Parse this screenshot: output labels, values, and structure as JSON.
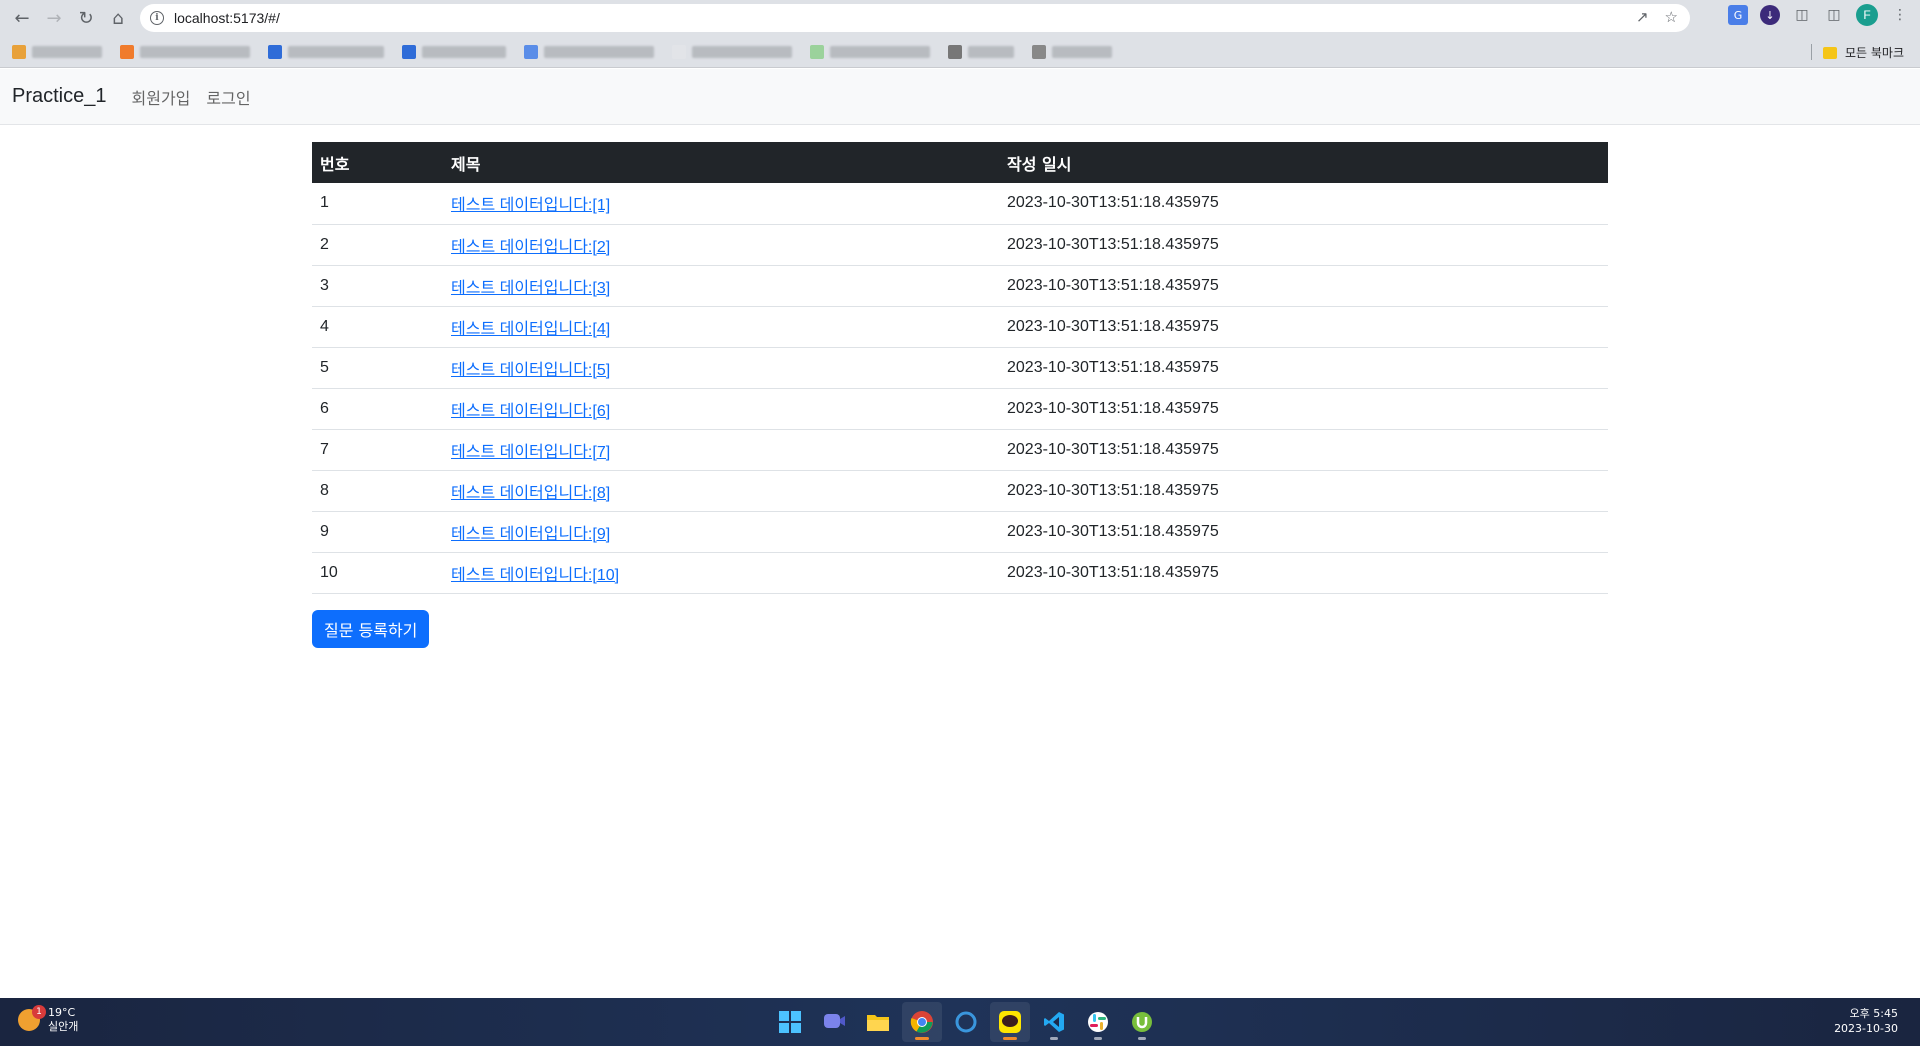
{
  "browser": {
    "url": "localhost:5173/#/",
    "all_bookmarks_label": "모든 북마크",
    "profile_initial": "F"
  },
  "app": {
    "brand": "Practice_1",
    "nav": {
      "signup": "회원가입",
      "login": "로그인"
    }
  },
  "table": {
    "headers": [
      "번호",
      "제목",
      "작성 일시"
    ],
    "rows": [
      {
        "num": "1",
        "title": "테스트 데이터입니다:[1]",
        "date": "2023-10-30T13:51:18.435975"
      },
      {
        "num": "2",
        "title": "테스트 데이터입니다:[2]",
        "date": "2023-10-30T13:51:18.435975"
      },
      {
        "num": "3",
        "title": "테스트 데이터입니다:[3]",
        "date": "2023-10-30T13:51:18.435975"
      },
      {
        "num": "4",
        "title": "테스트 데이터입니다:[4]",
        "date": "2023-10-30T13:51:18.435975"
      },
      {
        "num": "5",
        "title": "테스트 데이터입니다:[5]",
        "date": "2023-10-30T13:51:18.435975"
      },
      {
        "num": "6",
        "title": "테스트 데이터입니다:[6]",
        "date": "2023-10-30T13:51:18.435975"
      },
      {
        "num": "7",
        "title": "테스트 데이터입니다:[7]",
        "date": "2023-10-30T13:51:18.435975"
      },
      {
        "num": "8",
        "title": "테스트 데이터입니다:[8]",
        "date": "2023-10-30T13:51:18.435975"
      },
      {
        "num": "9",
        "title": "테스트 데이터입니다:[9]",
        "date": "2023-10-30T13:51:18.435975"
      },
      {
        "num": "10",
        "title": "테스트 데이터입니다:[10]",
        "date": "2023-10-30T13:51:18.435975"
      }
    ]
  },
  "actions": {
    "create_question": "질문 등록하기"
  },
  "taskbar": {
    "weather_temp": "19°C",
    "weather_desc": "실안개",
    "weather_badge": "1",
    "time": "오후 5:45",
    "date": "2023-10-30",
    "apps": [
      "windows-start-icon",
      "teams-chat-icon",
      "file-explorer-icon",
      "chrome-icon",
      "cortana-icon",
      "kakaotalk-icon",
      "vscode-icon",
      "slack-icon",
      "utorrent-icon"
    ]
  },
  "colors": {
    "primary": "#0d6efd",
    "table_header_bg": "#212529",
    "navbar_bg": "#f8f9fa"
  }
}
